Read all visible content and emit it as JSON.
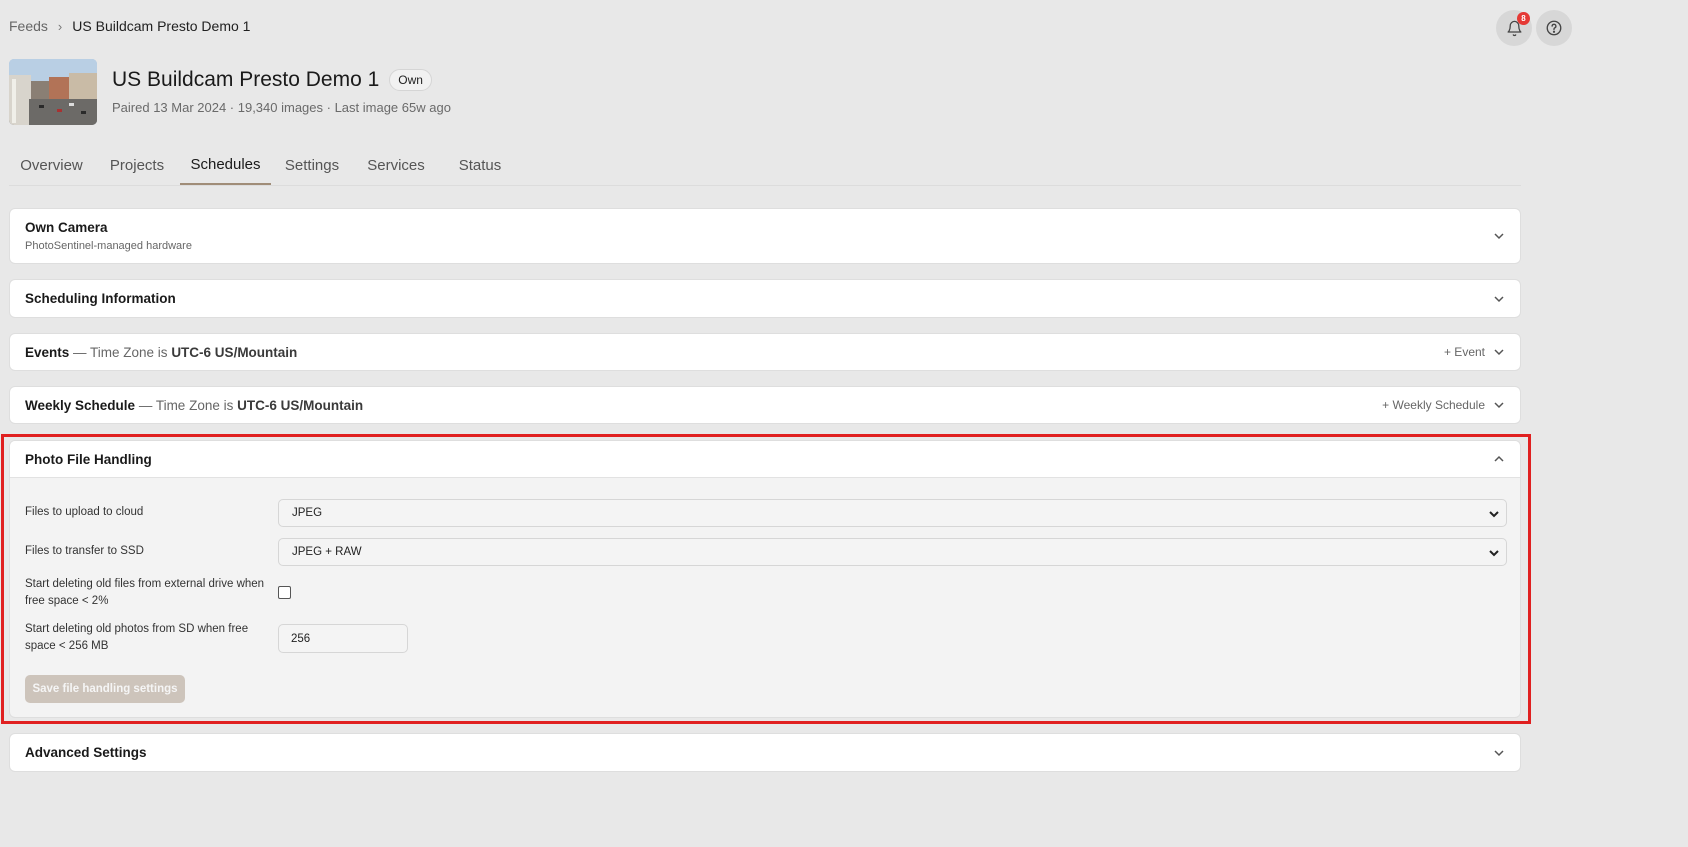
{
  "breadcrumb": {
    "root": "Feeds",
    "current": "US Buildcam Presto Demo 1"
  },
  "notifications": {
    "count": "8"
  },
  "feed": {
    "title": "US Buildcam Presto Demo 1",
    "ownership": "Own",
    "meta": "Paired 13 Mar 2024 · 19,340 images · Last image 65w ago"
  },
  "tabs": [
    "Overview",
    "Projects",
    "Schedules",
    "Settings",
    "Services",
    "Status"
  ],
  "active_tab": "Schedules",
  "panels": {
    "own_camera": {
      "title": "Own Camera",
      "subtitle": "PhotoSentinel-managed hardware"
    },
    "scheduling": {
      "title": "Scheduling Information"
    },
    "events": {
      "title": "Events",
      "tz_prefix": " — Time Zone is ",
      "tz_value": "UTC-6 US/Mountain",
      "add_label": "+ Event"
    },
    "weekly": {
      "title": "Weekly Schedule",
      "tz_prefix": " — Time Zone is ",
      "tz_value": "UTC-6 US/Mountain",
      "add_label": "+ Weekly Schedule"
    },
    "photo_file_handling": {
      "title": "Photo File Handling",
      "upload_label": "Files to upload to cloud",
      "upload_value": "JPEG",
      "ssd_label": "Files to transfer to SSD",
      "ssd_value": "JPEG + RAW",
      "external_label": "Start deleting old files from external drive when free space < 2%",
      "external_checked": false,
      "sd_label": "Start deleting old photos from SD when free space < 256 MB",
      "sd_value": "256",
      "save_label": "Save file handling settings"
    },
    "advanced": {
      "title": "Advanced Settings"
    }
  },
  "colors": {
    "accent_tab": "#a08d78",
    "highlight": "#e02020",
    "badge": "#e53935",
    "save_disabled": "#cdc4bb"
  }
}
